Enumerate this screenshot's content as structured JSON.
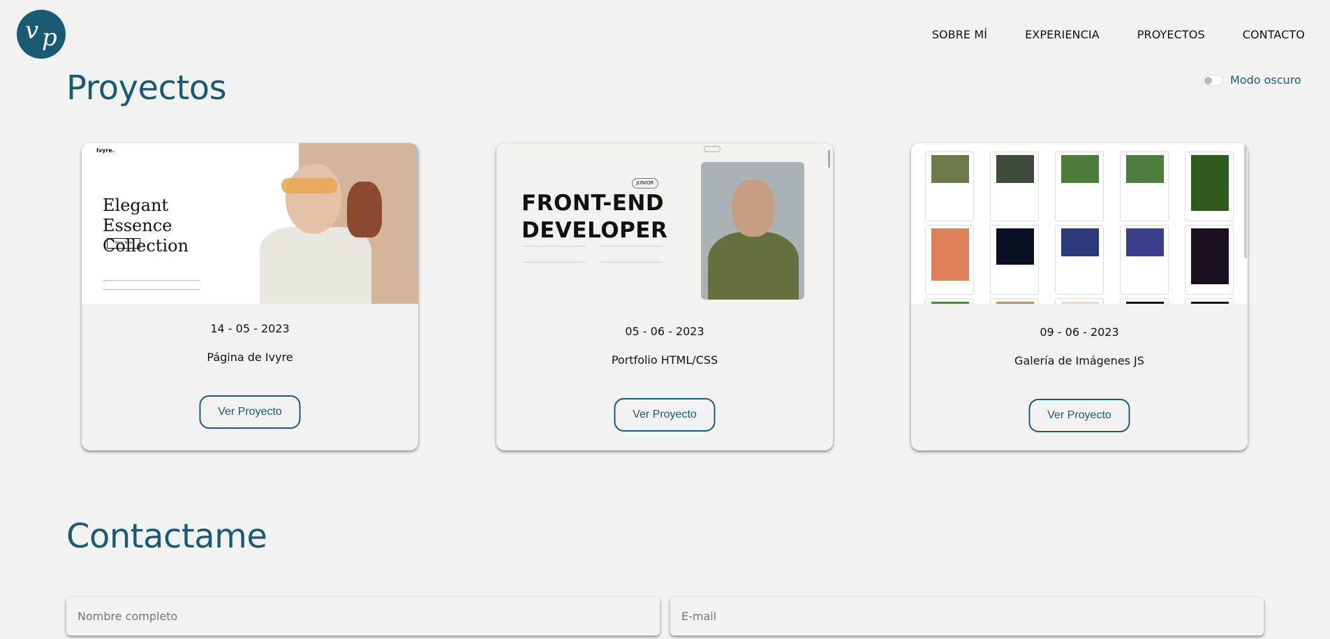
{
  "logo": {
    "letter1": "v",
    "letter2": "p"
  },
  "nav": [
    {
      "label": "SOBRE MÍ"
    },
    {
      "label": "EXPERIENCIA"
    },
    {
      "label": "PROYECTOS"
    },
    {
      "label": "CONTACTO"
    }
  ],
  "dark_mode": {
    "label": "Modo oscuro",
    "enabled": false
  },
  "projects_section": {
    "title": "Proyectos"
  },
  "projects": [
    {
      "date": "14 - 05 - 2023",
      "title": "Página de Ivyre",
      "button": "Ver Proyecto",
      "preview": {
        "brand": "Ivyre.",
        "heading": "Elegant Essence Collection",
        "cta": "Shop Now"
      }
    },
    {
      "date": "05 - 06 - 2023",
      "title": "Portfolio HTML/CSS",
      "button": "Ver Proyecto",
      "preview": {
        "badge": "JUNIOR",
        "heading": "FRONT-END DEVELOPER"
      }
    },
    {
      "date": "09 - 06 - 2023",
      "title": "Galería de Imágenes JS",
      "button": "Ver Proyecto",
      "preview": {}
    }
  ],
  "contact_section": {
    "title": "Contactame"
  },
  "contact_form": {
    "name_placeholder": "Nombre completo",
    "email_placeholder": "E-mail"
  },
  "colors": {
    "accent": "#1a5b73",
    "background": "#f2f2f2"
  }
}
